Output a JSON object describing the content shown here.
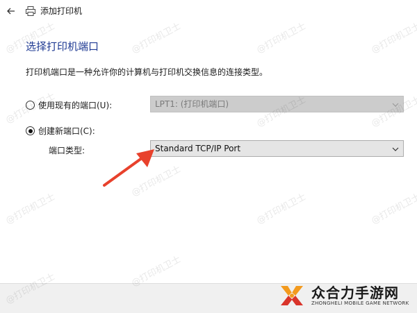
{
  "window": {
    "back_icon": "back-arrow-icon",
    "printer_icon": "printer-icon",
    "title": "添加打印机"
  },
  "page": {
    "heading": "选择打印机端口",
    "description": "打印机端口是一种允许你的计算机与打印机交换信息的连接类型。"
  },
  "existing_port": {
    "label": "使用现有的端口(U):",
    "selected": false,
    "value": "LPT1: (打印机端口)",
    "enabled": false
  },
  "new_port": {
    "label": "创建新端口(C):",
    "selected": true,
    "type_label": "端口类型:",
    "value": "Standard TCP/IP Port"
  },
  "annotation": {
    "arrow_color": "#e8412c"
  },
  "watermark": {
    "text": "@打印机卫士"
  },
  "logo": {
    "text_cn": "众合力手游网",
    "text_en": "ZHONGHELI MOBILE GAME NETWORK"
  },
  "colors": {
    "heading": "#1f3a93",
    "disabled_select_bg": "#cccccc",
    "active_select_bg": "#e5e5e5",
    "footer_bg": "#f0f0f0",
    "logo_orange": "#f39a1e",
    "logo_red": "#d9342b"
  }
}
